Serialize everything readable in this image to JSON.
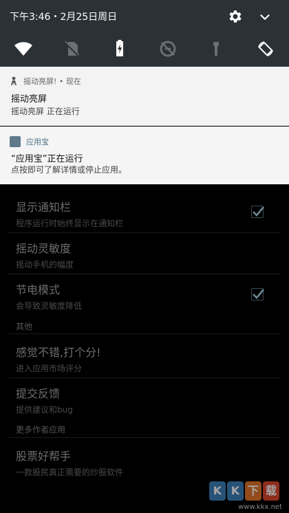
{
  "status": {
    "time": "下午3:46・2月25日周日"
  },
  "quick_tiles": [
    "wifi-icon",
    "no-sim-icon",
    "battery-charging-icon",
    "data-saver-icon",
    "flashlight-icon",
    "auto-rotate-icon"
  ],
  "notifications": [
    {
      "app": "摇动亮屏! • 现在",
      "title": "摇动亮屏",
      "text": "摇动亮屏 正在运行"
    },
    {
      "app": "应用宝",
      "title": "“应用宝”正在运行",
      "text": "点按即可了解详情或停止应用。"
    }
  ],
  "settings": {
    "show_bar": {
      "title": "显示通知栏",
      "summary": "程序运行时始终显示在通知栏",
      "checked": true
    },
    "sensitivity": {
      "title": "摇动灵敏度",
      "summary": "摇动手机的幅度"
    },
    "power_save": {
      "title": "节电模式",
      "summary": "会导致灵敏度降低",
      "checked": true
    },
    "other_header": "其他",
    "rate": {
      "title": "感觉不错,打个分!",
      "summary": "进入应用市场评分"
    },
    "feedback": {
      "title": "提交反馈",
      "summary": "提供建议和bug"
    },
    "more_header": "更多作者应用",
    "stock": {
      "title": "股票好帮手",
      "summary": "一款股民真正需要的炒股软件"
    }
  },
  "watermark": {
    "logo": [
      "K",
      "K",
      "下",
      "载"
    ],
    "url": "www.kkx.net"
  },
  "colors": {
    "panel": "#2b3135",
    "card": "#f3f3f3",
    "check": "#6f8796"
  }
}
